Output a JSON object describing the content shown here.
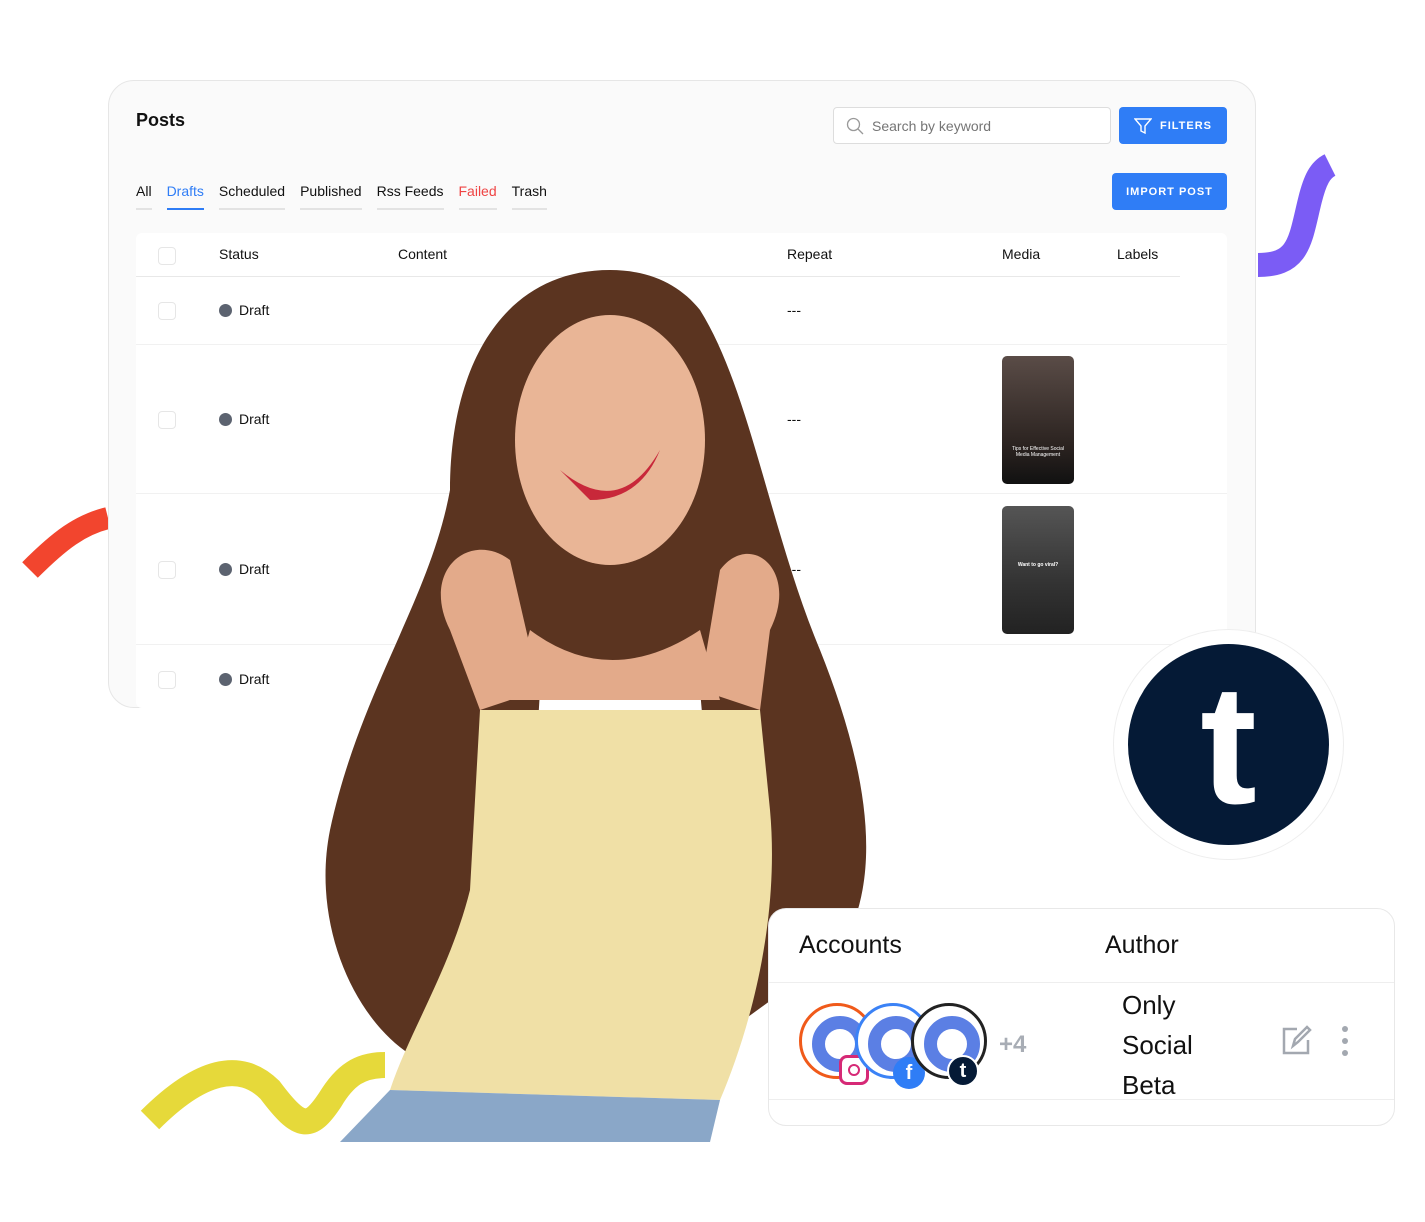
{
  "posts": {
    "title": "Posts",
    "search_placeholder": "Search by keyword",
    "filters_label": "FILTERS",
    "import_label": "IMPORT POST",
    "tabs": [
      {
        "label": "All"
      },
      {
        "label": "Drafts"
      },
      {
        "label": "Scheduled"
      },
      {
        "label": "Published"
      },
      {
        "label": "Rss Feeds"
      },
      {
        "label": "Failed"
      },
      {
        "label": "Trash"
      }
    ],
    "active_tab": "Drafts",
    "columns": [
      "Status",
      "Content",
      "Repeat",
      "Media",
      "Labels"
    ],
    "rows": [
      {
        "status": "Draft",
        "repeat": "---"
      },
      {
        "status": "Draft",
        "repeat": "---",
        "media_caption": "Tips for Effective Social Media Management"
      },
      {
        "status": "Draft",
        "repeat": "---",
        "media_caption": "Want to go viral?"
      },
      {
        "status": "Draft"
      }
    ]
  },
  "accounts_card": {
    "accounts_header": "Accounts",
    "author_header": "Author",
    "more_count": "+4",
    "author_lines": [
      "Only",
      "Social",
      "Beta"
    ],
    "networks": [
      "instagram",
      "facebook",
      "tumblr"
    ]
  },
  "tumblr_logo": "t",
  "colors": {
    "accent": "#2f7df6",
    "failed": "#ef4444",
    "tumblr": "#051a36",
    "purple": "#7b5cf5",
    "red": "#f2452e",
    "yellow": "#e6d93a"
  }
}
